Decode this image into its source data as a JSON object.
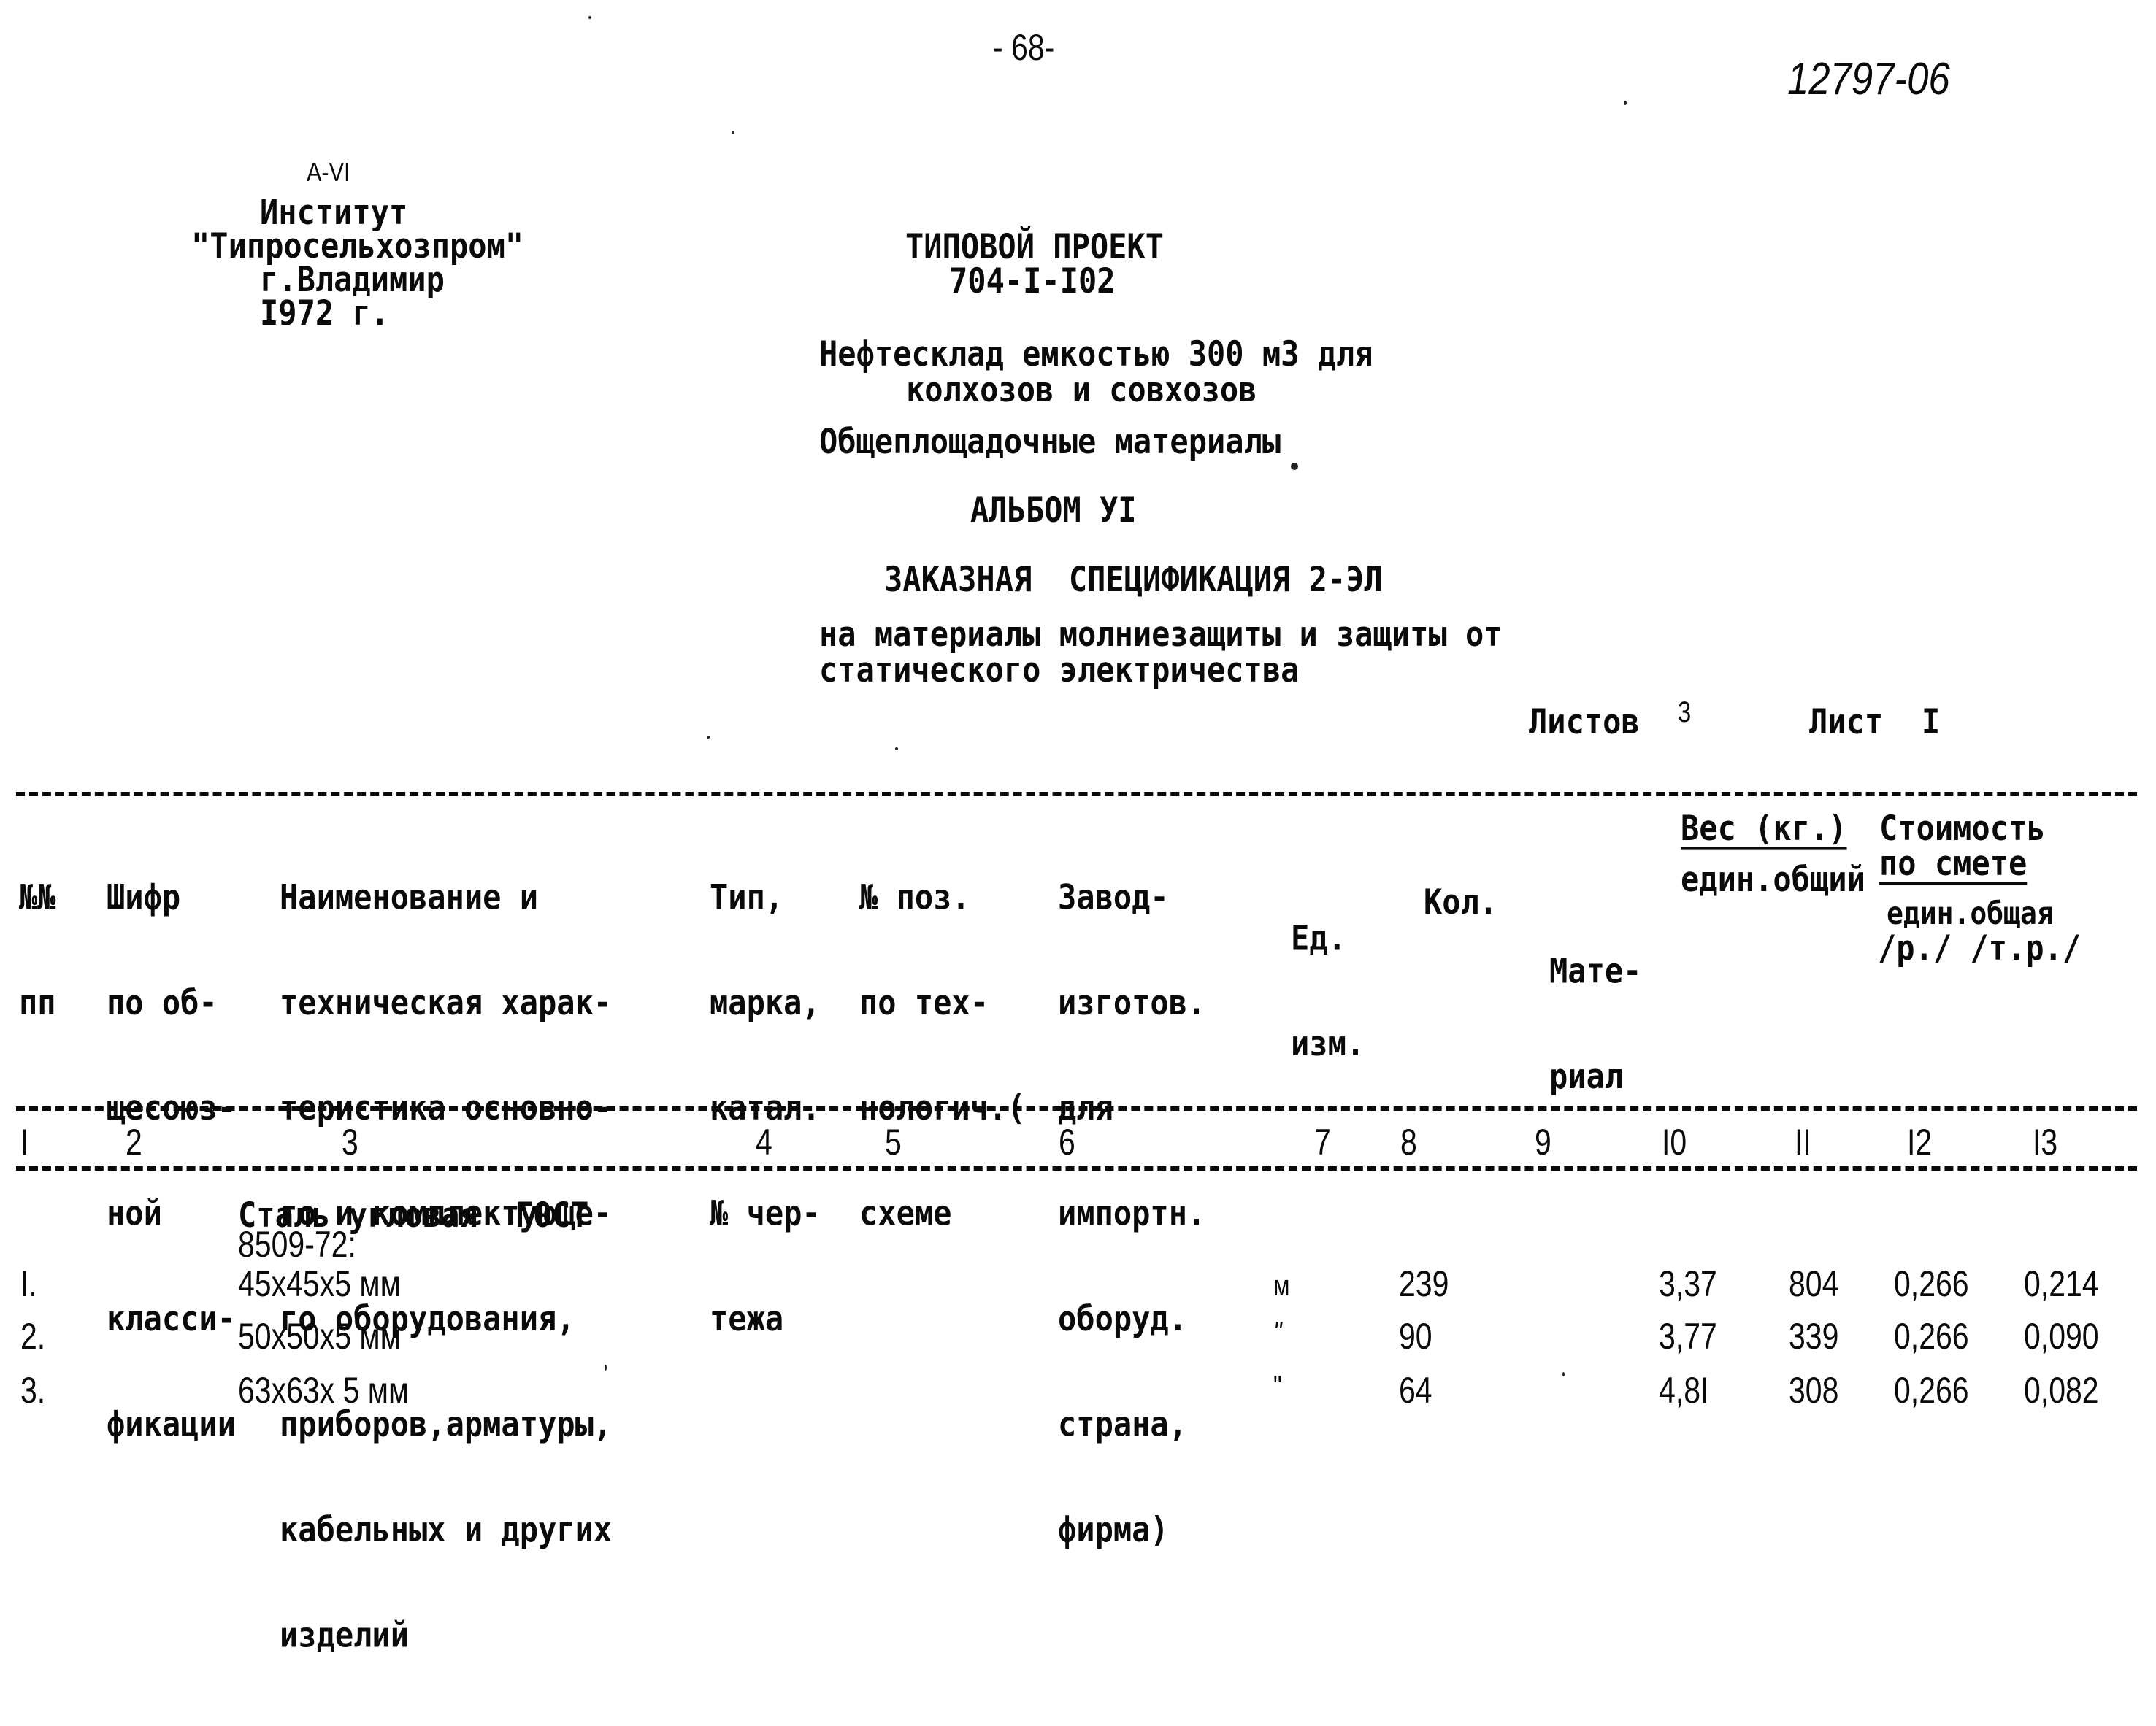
{
  "page": {
    "page_number": "- 68-",
    "archive_number": "12797-06",
    "album_mark": "А-VI"
  },
  "institute": {
    "lines": [
      "Институт",
      "\"Типросельхозпром\"",
      "г.Владимир",
      "I972 г."
    ]
  },
  "title_block": {
    "project_type": "ТИПОВОЙ ПРОЕКТ",
    "project_number": "704-I-I02",
    "object_line1": "Нефтесклад емкостью 300 м3 для",
    "object_line2": "колхозов и совхозов",
    "section": "Общеплощадочные материалы",
    "album": "АЛЬБОМ УI",
    "spec_title": "ЗАКАЗНАЯ  СПЕЦИФИКАЦИЯ 2-ЭЛ",
    "spec_subtitle_line1": "на материалы молниезащиты и защиты от",
    "spec_subtitle_line2": "статического электричества",
    "sheets_label": "Листов",
    "sheets_total": "3",
    "sheet_label": "Лист",
    "sheet_number": "I"
  },
  "table": {
    "headers": {
      "c1": [
        "№№",
        "пп"
      ],
      "c2": [
        "Шифр",
        "по об-",
        "щесоюз-",
        "ной",
        "класси-",
        "фикации"
      ],
      "c3": [
        "Наименование и",
        "техническая харак-",
        "теристика основно-",
        "го и комплектующе-",
        "го оборудования,",
        "приборов,арматуры,",
        "кабельных и других",
        "изделий"
      ],
      "c4": [
        "Тип,",
        "марка,",
        "катал.",
        "№ чер-",
        "тежа"
      ],
      "c5": [
        "№ поз.",
        "по тех-",
        "нологич.(",
        "схеме"
      ],
      "c6": [
        "Завод-",
        "изготов.",
        "для",
        "импортн.",
        "оборуд.",
        "страна,",
        "фирма)"
      ],
      "c7": [
        "Ед.",
        "изм."
      ],
      "c8": [
        "Кол."
      ],
      "c9": [
        "Мате-",
        "риал"
      ],
      "weight_group": "Вес (кг.)",
      "weight_sub": "един.общий",
      "cost_group_line1": "Стоимость",
      "cost_group_line2": "по смете",
      "cost_sub_line1": "един.общая",
      "cost_sub_line2": "/р./ /т.р./"
    },
    "column_numbers": [
      "I",
      "2",
      "3",
      "4",
      "5",
      "6",
      "7",
      "8",
      "9",
      "I0",
      "II",
      "I2",
      "I3"
    ],
    "group_title_line1": "Сталь угловая  ГОСТ",
    "group_title_line2": "8509-72:",
    "rows": [
      {
        "num": "I.",
        "name": "45х45х5 мм",
        "unit": "м",
        "qty": "239",
        "weight_unit": "3,37",
        "weight_total": "804",
        "cost_unit": "0,266",
        "cost_total": "0,214"
      },
      {
        "num": "2.",
        "name": "50х50х5 мм",
        "unit": "\"",
        "qty": "90",
        "weight_unit": "3,77",
        "weight_total": "339",
        "cost_unit": "0,266",
        "cost_total": "0,090"
      },
      {
        "num": "3.",
        "name": "63х63х 5 мм",
        "unit": "\"",
        "qty": "64",
        "weight_unit": "4,8I",
        "weight_total": "308",
        "cost_unit": "0,266",
        "cost_total": "0,082"
      }
    ]
  }
}
